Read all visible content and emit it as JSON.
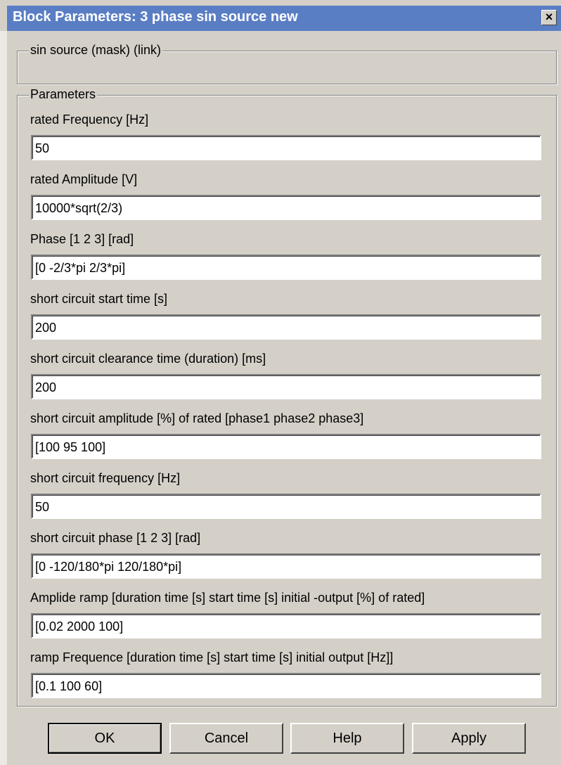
{
  "window": {
    "title": "Block Parameters: 3 phase sin source new",
    "close_glyph": "×"
  },
  "mask_group": {
    "label": "sin source (mask) (link)"
  },
  "params_group": {
    "label": "Parameters",
    "fields": [
      {
        "label": "rated Frequency [Hz]",
        "value": "50"
      },
      {
        "label": "rated Amplitude [V]",
        "value": "10000*sqrt(2/3)"
      },
      {
        "label": "Phase [1 2 3] [rad]",
        "value": "[0 -2/3*pi  2/3*pi]"
      },
      {
        "label": "short circuit start time [s]",
        "value": "200"
      },
      {
        "label": "short circuit clearance time (duration) [ms]",
        "value": "200"
      },
      {
        "label": "short circuit amplitude [%] of rated  [phase1 phase2 phase3]",
        "value": "[100 95 100]"
      },
      {
        "label": "short circuit frequency [Hz]",
        "value": "50"
      },
      {
        "label": "short circuit phase [1 2 3] [rad]",
        "value": "[0 -120/180*pi  120/180*pi]"
      },
      {
        "label": "Amplide ramp [duration time [s]   start time [s]   initial -output [%] of rated]",
        "value": "[0.02 2000 100]"
      },
      {
        "label": "ramp Frequence [duration time [s]   start time [s]   initial output [Hz]]",
        "value": "[0.1 100 60]"
      }
    ]
  },
  "buttons": {
    "ok": "OK",
    "cancel": "Cancel",
    "help": "Help",
    "apply": "Apply"
  }
}
